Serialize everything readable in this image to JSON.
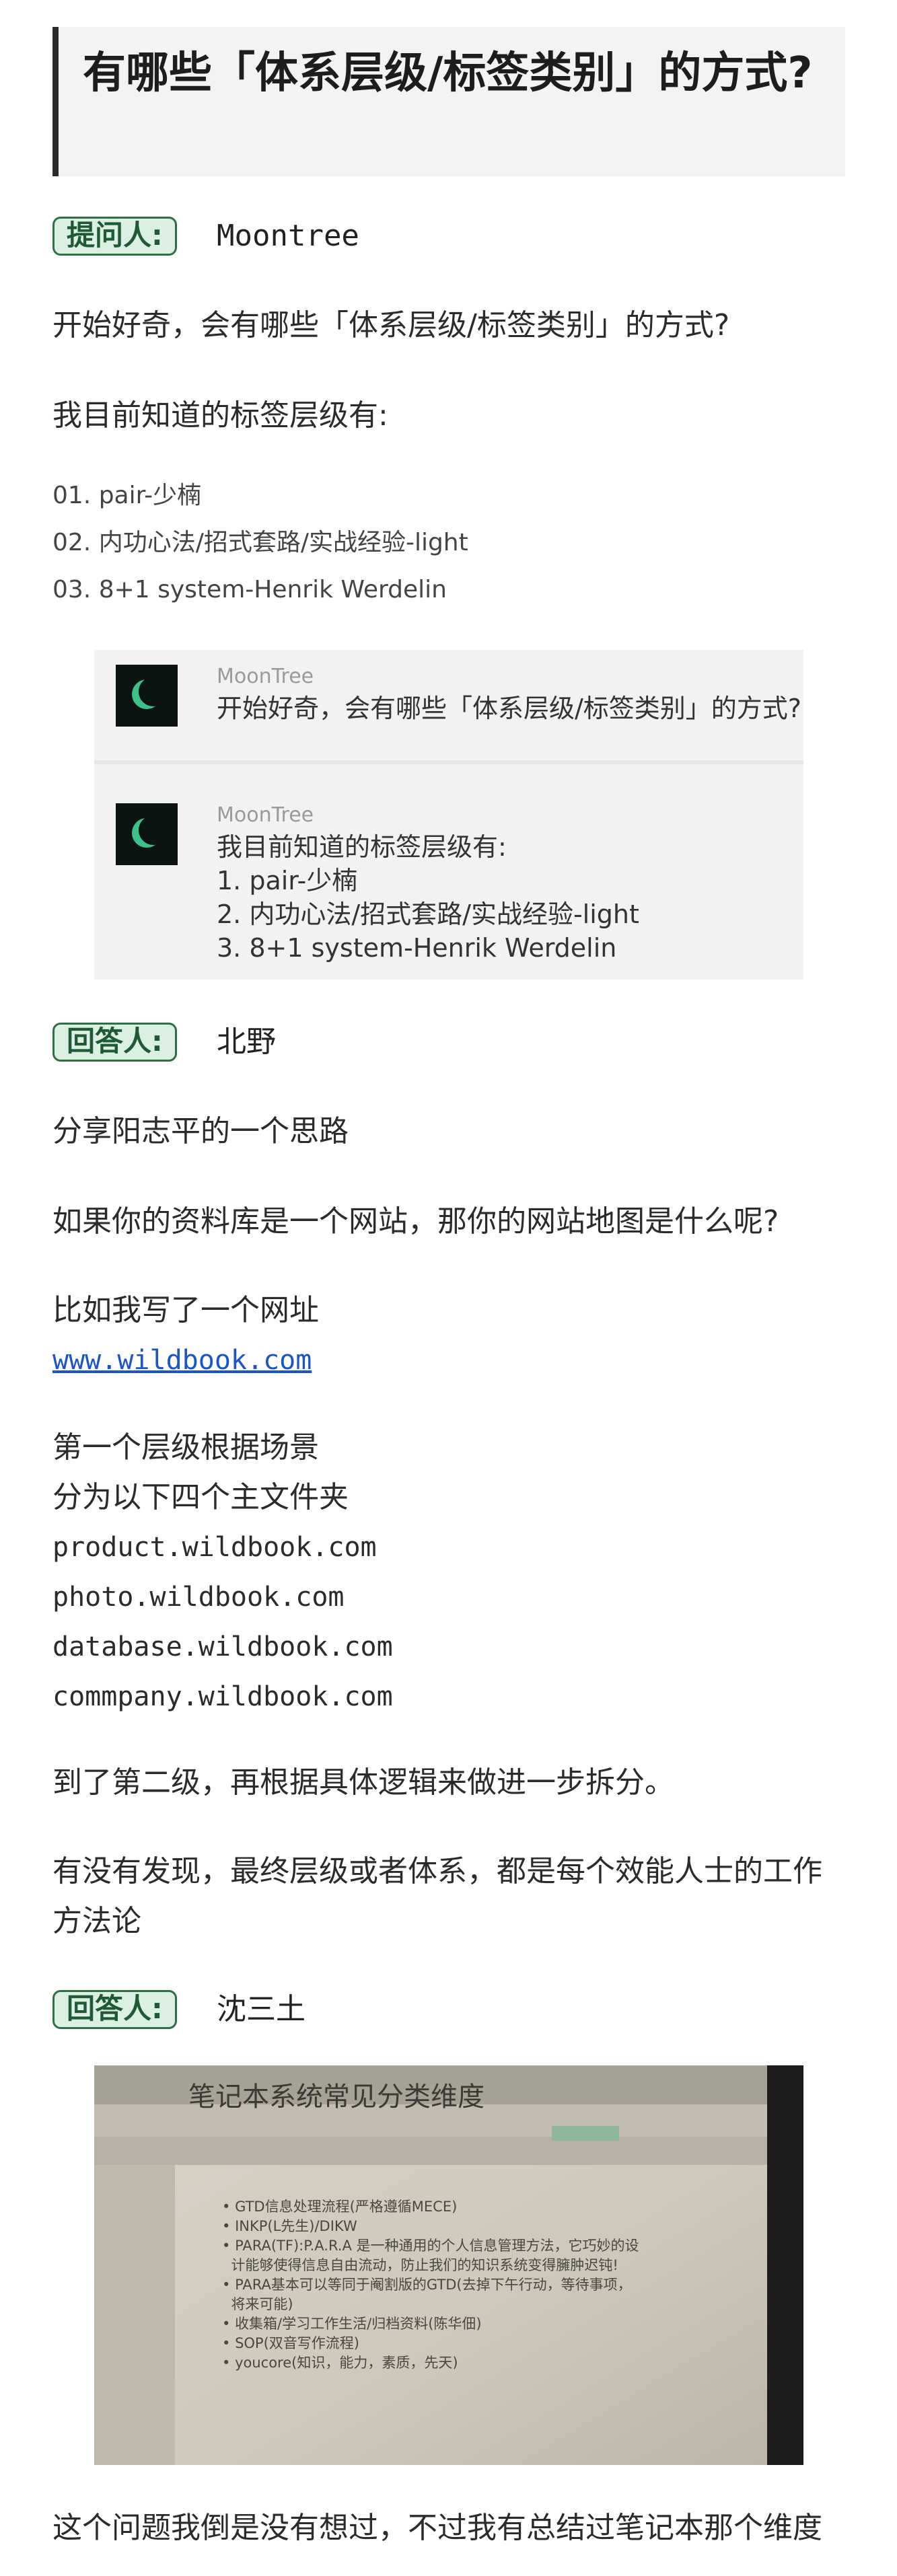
{
  "question": {
    "title": "有哪些「体系层级/标签类别」的方式?",
    "asker_badge": "提问人:",
    "asker_name": "Moontree",
    "intro": "开始好奇，会有哪些「体系层级/标签类别」的方式?",
    "known_label": "我目前知道的标签层级有:",
    "list": [
      "01. pair-少楠",
      "02. 内功心法/招式套路/实战经验-light",
      "03. 8+1 system-Henrik Werdelin"
    ],
    "chat": {
      "msg1": {
        "nick": "MoonTree",
        "text": "开始好奇，会有哪些「体系层级/标签类别」的方式?"
      },
      "msg2": {
        "nick": "MoonTree",
        "lines": [
          "我目前知道的标签层级有:",
          "1. pair-少楠",
          "2. 内功心法/招式套路/实战经验-light",
          "3. 8+1 system-Henrik Werdelin"
        ]
      }
    }
  },
  "answer1": {
    "badge": "回答人:",
    "name": "北野",
    "p1": "分享阳志平的一个思路",
    "p2": "如果你的资料库是一个网站，那你的网站地图是什么呢?",
    "p3": "比如我写了一个网址",
    "link": "www.wildbook.com",
    "p4a": "第一个层级根据场景",
    "p4b": "分为以下四个主文件夹",
    "folders": [
      "product.wildbook.com",
      "photo.wildbook.com",
      "database.wildbook.com",
      "commpany.wildbook.com"
    ],
    "p5": "到了第二级，再根据具体逻辑来做进一步拆分。",
    "p6a": "有没有发现，最终层级或者体系，都是每个效能人士的工作",
    "p6b": "方法论"
  },
  "answer2": {
    "badge": "回答人:",
    "name": "沈三土",
    "photo": {
      "heading": "笔记本系统常见分类维度",
      "bullets": [
        "GTD信息处理流程(严格遵循MECE)",
        "INKP(L先生)/DIKW",
        "PARA(TF):P.A.R.A 是一种通用的个人信息管理方法，它巧妙的设",
        "计能够使得信息自由流动，防止我们的知识系统变得臃肿迟钝!",
        "PARA基本可以等同于阉割版的GTD(去掉下午行动，等待事项，",
        "将来可能)",
        "收集箱/学习工作生活/归档资料(陈华佃)",
        "SOP(双音写作流程)",
        "youcore(知识，能力，素质，先天)"
      ]
    },
    "closing": "这个问题我倒是没有想过，不过我有总结过笔记本那个维度"
  },
  "colors": {
    "badge_bg": "#dcefe3",
    "badge_border": "#2f6f45",
    "link": "#1a56c8",
    "title_bar": "#2b2b2b"
  }
}
